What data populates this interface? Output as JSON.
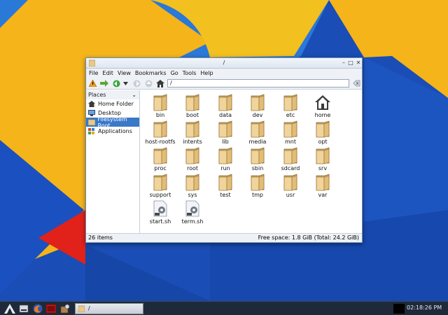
{
  "window": {
    "title": "/",
    "menu": [
      "File",
      "Edit",
      "View",
      "Bookmarks",
      "Go",
      "Tools",
      "Help"
    ],
    "location": "/"
  },
  "sidebar": {
    "header": "Places",
    "items": [
      {
        "label": "Home Folder",
        "icon": "home-icon"
      },
      {
        "label": "Desktop",
        "icon": "desktop-icon"
      },
      {
        "label": "Filesystem Root",
        "icon": "folder-icon",
        "selected": true
      },
      {
        "label": "Applications",
        "icon": "applications-icon"
      }
    ]
  },
  "files": [
    {
      "name": "bin",
      "type": "folder"
    },
    {
      "name": "boot",
      "type": "folder"
    },
    {
      "name": "data",
      "type": "folder"
    },
    {
      "name": "dev",
      "type": "folder"
    },
    {
      "name": "etc",
      "type": "folder"
    },
    {
      "name": "home",
      "type": "home"
    },
    {
      "name": "host-rootfs",
      "type": "folder"
    },
    {
      "name": "intents",
      "type": "folder"
    },
    {
      "name": "lib",
      "type": "folder"
    },
    {
      "name": "media",
      "type": "folder"
    },
    {
      "name": "mnt",
      "type": "folder"
    },
    {
      "name": "opt",
      "type": "folder"
    },
    {
      "name": "proc",
      "type": "folder"
    },
    {
      "name": "root",
      "type": "folder"
    },
    {
      "name": "run",
      "type": "folder"
    },
    {
      "name": "sbin",
      "type": "folder"
    },
    {
      "name": "sdcard",
      "type": "folder"
    },
    {
      "name": "srv",
      "type": "folder"
    },
    {
      "name": "support",
      "type": "folder"
    },
    {
      "name": "sys",
      "type": "folder"
    },
    {
      "name": "test",
      "type": "folder"
    },
    {
      "name": "tmp",
      "type": "folder"
    },
    {
      "name": "usr",
      "type": "folder"
    },
    {
      "name": "var",
      "type": "folder"
    },
    {
      "name": "start.sh",
      "type": "script"
    },
    {
      "name": "term.sh",
      "type": "script"
    }
  ],
  "status": {
    "count": "26 items",
    "free": "Free space: 1.8 GiB (Total: 24.2 GiB)"
  },
  "taskbar": {
    "task_label": "/",
    "clock": "02:18:26 PM"
  },
  "colors": {
    "selection": "#3a78c8",
    "folder": "#e8c98a",
    "wallpaper_blue": "#1a4db5",
    "wallpaper_yellow": "#f4b41a",
    "wallpaper_red": "#e0221a"
  }
}
